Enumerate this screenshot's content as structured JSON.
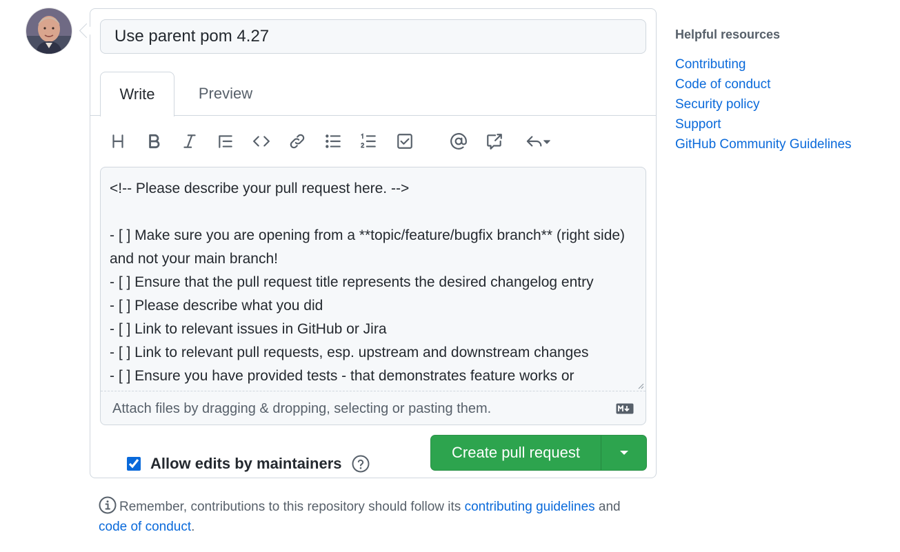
{
  "form": {
    "title_value": "Use parent pom 4.27",
    "tabs": [
      {
        "label": "Write",
        "active": true
      },
      {
        "label": "Preview",
        "active": false
      }
    ],
    "toolbar_icons": [
      "heading-icon",
      "bold-icon",
      "italic-icon",
      "quote-icon",
      "code-icon",
      "link-icon",
      "unordered-list-icon",
      "ordered-list-icon",
      "task-list-icon",
      "mention-icon",
      "cross-reference-icon",
      "saved-replies-icon"
    ],
    "body_text": "<!-- Please describe your pull request here. -->\n\n- [ ] Make sure you are opening from a **topic/feature/bugfix branch** (right side) and not your main branch!\n- [ ] Ensure that the pull request title represents the desired changelog entry\n- [ ] Please describe what you did\n- [ ] Link to relevant issues in GitHub or Jira\n- [ ] Link to relevant pull requests, esp. upstream and downstream changes\n- [ ] Ensure you have provided tests - that demonstrates feature works or",
    "attach_hint": "Attach files by dragging & dropping, selecting or pasting them.",
    "allow_edits_label": "Allow edits by maintainers",
    "allow_edits_checked": true,
    "create_button_label": "Create pull request"
  },
  "notice": {
    "text_before": "Remember, contributions to this repository should follow its",
    "link1": "contributing guidelines",
    "text_middle": "and",
    "link2": "code of conduct",
    "text_after": "."
  },
  "sidebar": {
    "title": "Helpful resources",
    "links": [
      "Contributing",
      "Code of conduct",
      "Security policy",
      "Support",
      "GitHub Community Guidelines"
    ]
  },
  "colors": {
    "accent": "#0969da",
    "primary_button": "#2da44e",
    "border": "#d0d7de",
    "muted_text": "#57606a"
  }
}
